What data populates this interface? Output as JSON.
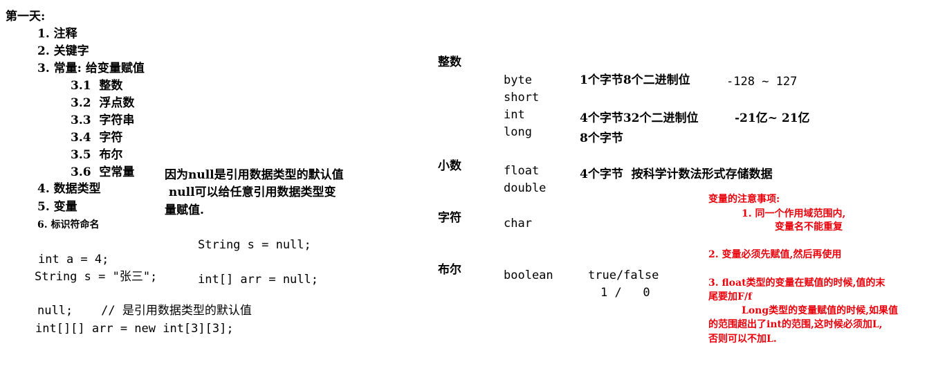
{
  "left": {
    "title": "第一天:",
    "outline": [
      "1. 注释",
      "2. 关键字",
      "3. 常量: 给变量赋值"
    ],
    "constants": [
      "3.1  整数",
      "3.2  浮点数",
      "3.3  字符串",
      "3.4  字符",
      "3.5  布尔",
      "3.6  空常量"
    ],
    "outline_more": [
      "4. 数据类型",
      "5. 变量",
      "6. 标识符命名"
    ],
    "null_note": [
      "因为null是引用数据类型的默认值",
      " null可以给任意引用数据类型变",
      "量赋值."
    ],
    "code_left": [
      "int a = 4;",
      "String s = \"张三\";"
    ],
    "code_right": [
      "String s = null;",
      "int[] arr = null;"
    ],
    "code_bottom": [
      "null;    // 是引用数据类型的默认值",
      "int[][] arr = new int[3][3];"
    ]
  },
  "types": {
    "integer_label": "整数",
    "integer_types": [
      "byte",
      "short",
      "int",
      "long"
    ],
    "byte_desc": "1个字节8个二进制位",
    "byte_range": "-128 ~ 127",
    "int_desc": "4个字节32个二进制位",
    "int_range": "-21亿~ 21亿",
    "long_desc": "8个字节",
    "decimal_label": "小数",
    "decimal_types": [
      "float",
      "double"
    ],
    "float_desc": "4个字节  按科学计数法形式存储数据",
    "char_label": "字符",
    "char_type": "char",
    "bool_label": "布尔",
    "bool_type": "boolean",
    "bool_values": "true/false",
    "bool_numeric": "1 /   0"
  },
  "notes": {
    "title": "变量的注意事项:",
    "item1_a": "1. 同一个作用域范围内,",
    "item1_b": "变量名不能重复",
    "item2": "2. 变量必须先赋值,然后再使用",
    "item3_a": "3. float类型的变量在赋值的时候,值的末",
    "item3_b": "尾要加F/f",
    "item3_c": "Long类型的变量赋值的时候,如果值",
    "item3_d": "的范围超出了int的范围,这时候必须加L,",
    "item3_e": "否则可以不加L."
  },
  "colors": {
    "text": "#000000",
    "note_red": "#e8000b",
    "background": "#ffffff"
  }
}
